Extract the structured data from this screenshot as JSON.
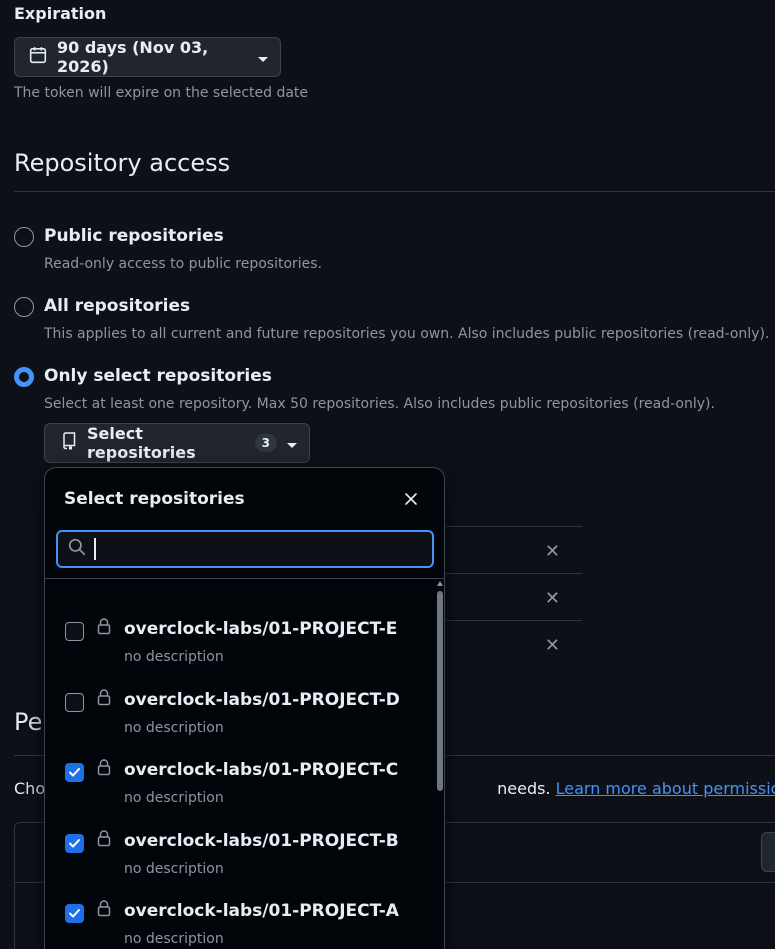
{
  "expiration": {
    "label": "Expiration",
    "selected": "90 days (Nov 03, 2026)",
    "hint": "The token will expire on the selected date"
  },
  "repository_access": {
    "title": "Repository access",
    "options": [
      {
        "title": "Public repositories",
        "description": "Read-only access to public repositories.",
        "checked": false
      },
      {
        "title": "All repositories",
        "description": "This applies to all current and future repositories you own. Also includes public repositories (read-only).",
        "checked": false
      },
      {
        "title": "Only select repositories",
        "description": "Select at least one repository. Max 50 repositories. Also includes public repositories (read-only).",
        "checked": true
      }
    ],
    "select_button": {
      "label": "Select repositories",
      "count": "3"
    }
  },
  "popover": {
    "title": "Select repositories",
    "search_value": "",
    "items": [
      {
        "name": "overclock-labs/01-PROJECT-E",
        "description": "no description",
        "checked": false
      },
      {
        "name": "overclock-labs/01-PROJECT-D",
        "description": "no description",
        "checked": false
      },
      {
        "name": "overclock-labs/01-PROJECT-C",
        "description": "no description",
        "checked": true
      },
      {
        "name": "overclock-labs/01-PROJECT-B",
        "description": "no description",
        "checked": true
      },
      {
        "name": "overclock-labs/01-PROJECT-A",
        "description": "no description",
        "checked": true
      }
    ]
  },
  "permissions": {
    "title_visible": "Pe",
    "text_prefix": "Cho",
    "text_suffix": "needs.",
    "link": "Learn more about permissions."
  },
  "colors": {
    "accent": "#4493f8",
    "checkbox": "#1f6feb",
    "background": "#0d1117"
  }
}
